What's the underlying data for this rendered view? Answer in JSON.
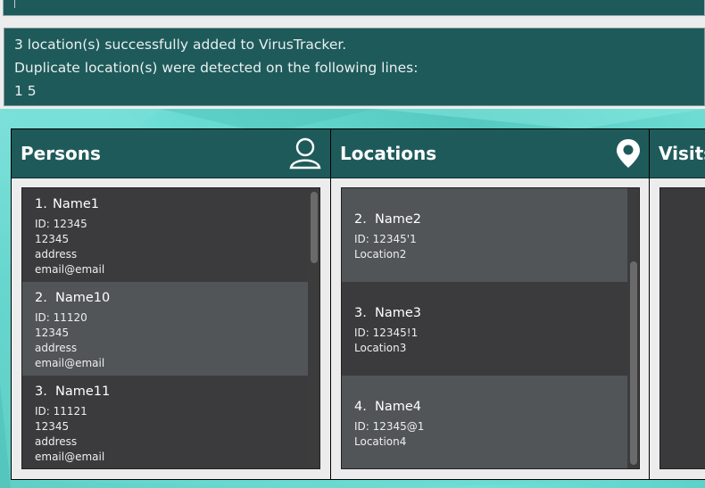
{
  "command": {
    "value": ""
  },
  "result": {
    "lines": [
      "3 location(s) successfully added to VirusTracker.",
      "Duplicate location(s) were detected on the following lines:",
      "1 5"
    ]
  },
  "panels": {
    "persons": {
      "title": "Persons",
      "icon": "person-icon",
      "items": [
        {
          "index": "1.",
          "name": "Name1",
          "id": "ID: 12345",
          "phone": "12345",
          "address": "address",
          "email": "email@email"
        },
        {
          "index": "2.",
          "name": "Name10",
          "id": "ID: 11120",
          "phone": "12345",
          "address": "address",
          "email": "email@email"
        },
        {
          "index": "3.",
          "name": "Name11",
          "id": "ID: 11121",
          "phone": "12345",
          "address": "address",
          "email": "email@email"
        }
      ]
    },
    "locations": {
      "title": "Locations",
      "icon": "location-pin-icon",
      "items": [
        {
          "index": "2.",
          "name": "Name2",
          "id": "ID: 12345'1",
          "address": "Location2"
        },
        {
          "index": "3.",
          "name": "Name3",
          "id": "ID: 12345!1",
          "address": "Location3"
        },
        {
          "index": "4.",
          "name": "Name4",
          "id": "ID: 12345@1",
          "address": "Location4"
        }
      ]
    },
    "visits": {
      "title": "Visits"
    }
  },
  "colors": {
    "header": "#1f5a5b",
    "card_dark": "#3b3b3d",
    "card_light": "#515557",
    "background_teal": "#5fcfc6"
  }
}
